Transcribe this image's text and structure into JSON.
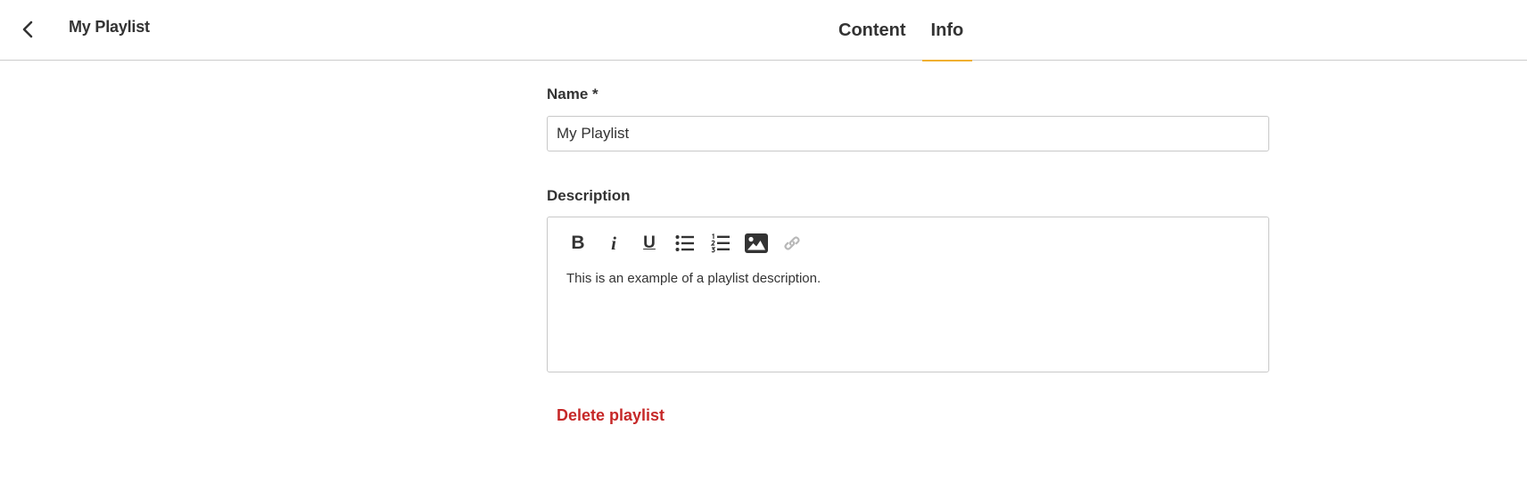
{
  "header": {
    "title": "My Playlist",
    "back_icon": "chevron-left-icon",
    "tabs": [
      {
        "label": "Content",
        "active": false
      },
      {
        "label": "Info",
        "active": true
      }
    ],
    "accent_color": "#f0b030"
  },
  "form": {
    "name": {
      "label": "Name *",
      "value": "My Playlist"
    },
    "description": {
      "label": "Description",
      "toolbar": [
        {
          "name": "bold",
          "glyph": "B"
        },
        {
          "name": "italic",
          "glyph": "i"
        },
        {
          "name": "underline",
          "glyph": "U"
        },
        {
          "name": "bullet-list",
          "icon": "bullet-list-icon"
        },
        {
          "name": "numbered-list",
          "icon": "numbered-list-icon"
        },
        {
          "name": "image",
          "icon": "image-icon"
        },
        {
          "name": "link",
          "icon": "link-icon",
          "disabled": true
        }
      ],
      "content": "This is an example of a playlist description."
    }
  },
  "actions": {
    "delete_label": "Delete playlist",
    "delete_color": "#c62828"
  }
}
